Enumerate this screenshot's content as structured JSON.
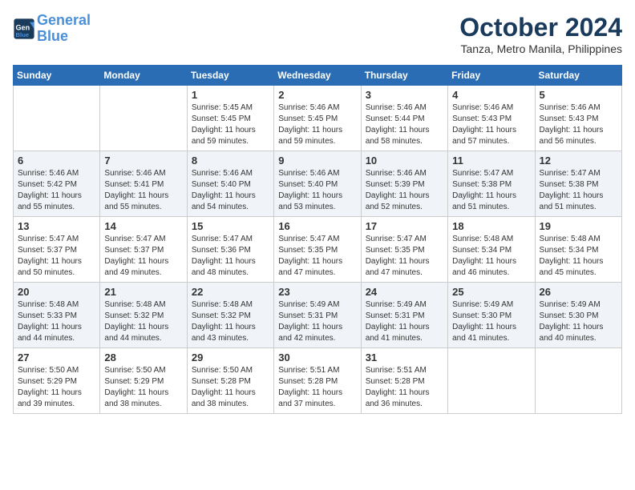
{
  "header": {
    "logo_line1": "General",
    "logo_line2": "Blue",
    "month": "October 2024",
    "location": "Tanza, Metro Manila, Philippines"
  },
  "days_of_week": [
    "Sunday",
    "Monday",
    "Tuesday",
    "Wednesday",
    "Thursday",
    "Friday",
    "Saturday"
  ],
  "weeks": [
    [
      {
        "day": "",
        "sunrise": "",
        "sunset": "",
        "daylight": ""
      },
      {
        "day": "",
        "sunrise": "",
        "sunset": "",
        "daylight": ""
      },
      {
        "day": "1",
        "sunrise": "Sunrise: 5:45 AM",
        "sunset": "Sunset: 5:45 PM",
        "daylight": "Daylight: 11 hours and 59 minutes."
      },
      {
        "day": "2",
        "sunrise": "Sunrise: 5:46 AM",
        "sunset": "Sunset: 5:45 PM",
        "daylight": "Daylight: 11 hours and 59 minutes."
      },
      {
        "day": "3",
        "sunrise": "Sunrise: 5:46 AM",
        "sunset": "Sunset: 5:44 PM",
        "daylight": "Daylight: 11 hours and 58 minutes."
      },
      {
        "day": "4",
        "sunrise": "Sunrise: 5:46 AM",
        "sunset": "Sunset: 5:43 PM",
        "daylight": "Daylight: 11 hours and 57 minutes."
      },
      {
        "day": "5",
        "sunrise": "Sunrise: 5:46 AM",
        "sunset": "Sunset: 5:43 PM",
        "daylight": "Daylight: 11 hours and 56 minutes."
      }
    ],
    [
      {
        "day": "6",
        "sunrise": "Sunrise: 5:46 AM",
        "sunset": "Sunset: 5:42 PM",
        "daylight": "Daylight: 11 hours and 55 minutes."
      },
      {
        "day": "7",
        "sunrise": "Sunrise: 5:46 AM",
        "sunset": "Sunset: 5:41 PM",
        "daylight": "Daylight: 11 hours and 55 minutes."
      },
      {
        "day": "8",
        "sunrise": "Sunrise: 5:46 AM",
        "sunset": "Sunset: 5:40 PM",
        "daylight": "Daylight: 11 hours and 54 minutes."
      },
      {
        "day": "9",
        "sunrise": "Sunrise: 5:46 AM",
        "sunset": "Sunset: 5:40 PM",
        "daylight": "Daylight: 11 hours and 53 minutes."
      },
      {
        "day": "10",
        "sunrise": "Sunrise: 5:46 AM",
        "sunset": "Sunset: 5:39 PM",
        "daylight": "Daylight: 11 hours and 52 minutes."
      },
      {
        "day": "11",
        "sunrise": "Sunrise: 5:47 AM",
        "sunset": "Sunset: 5:38 PM",
        "daylight": "Daylight: 11 hours and 51 minutes."
      },
      {
        "day": "12",
        "sunrise": "Sunrise: 5:47 AM",
        "sunset": "Sunset: 5:38 PM",
        "daylight": "Daylight: 11 hours and 51 minutes."
      }
    ],
    [
      {
        "day": "13",
        "sunrise": "Sunrise: 5:47 AM",
        "sunset": "Sunset: 5:37 PM",
        "daylight": "Daylight: 11 hours and 50 minutes."
      },
      {
        "day": "14",
        "sunrise": "Sunrise: 5:47 AM",
        "sunset": "Sunset: 5:37 PM",
        "daylight": "Daylight: 11 hours and 49 minutes."
      },
      {
        "day": "15",
        "sunrise": "Sunrise: 5:47 AM",
        "sunset": "Sunset: 5:36 PM",
        "daylight": "Daylight: 11 hours and 48 minutes."
      },
      {
        "day": "16",
        "sunrise": "Sunrise: 5:47 AM",
        "sunset": "Sunset: 5:35 PM",
        "daylight": "Daylight: 11 hours and 47 minutes."
      },
      {
        "day": "17",
        "sunrise": "Sunrise: 5:47 AM",
        "sunset": "Sunset: 5:35 PM",
        "daylight": "Daylight: 11 hours and 47 minutes."
      },
      {
        "day": "18",
        "sunrise": "Sunrise: 5:48 AM",
        "sunset": "Sunset: 5:34 PM",
        "daylight": "Daylight: 11 hours and 46 minutes."
      },
      {
        "day": "19",
        "sunrise": "Sunrise: 5:48 AM",
        "sunset": "Sunset: 5:34 PM",
        "daylight": "Daylight: 11 hours and 45 minutes."
      }
    ],
    [
      {
        "day": "20",
        "sunrise": "Sunrise: 5:48 AM",
        "sunset": "Sunset: 5:33 PM",
        "daylight": "Daylight: 11 hours and 44 minutes."
      },
      {
        "day": "21",
        "sunrise": "Sunrise: 5:48 AM",
        "sunset": "Sunset: 5:32 PM",
        "daylight": "Daylight: 11 hours and 44 minutes."
      },
      {
        "day": "22",
        "sunrise": "Sunrise: 5:48 AM",
        "sunset": "Sunset: 5:32 PM",
        "daylight": "Daylight: 11 hours and 43 minutes."
      },
      {
        "day": "23",
        "sunrise": "Sunrise: 5:49 AM",
        "sunset": "Sunset: 5:31 PM",
        "daylight": "Daylight: 11 hours and 42 minutes."
      },
      {
        "day": "24",
        "sunrise": "Sunrise: 5:49 AM",
        "sunset": "Sunset: 5:31 PM",
        "daylight": "Daylight: 11 hours and 41 minutes."
      },
      {
        "day": "25",
        "sunrise": "Sunrise: 5:49 AM",
        "sunset": "Sunset: 5:30 PM",
        "daylight": "Daylight: 11 hours and 41 minutes."
      },
      {
        "day": "26",
        "sunrise": "Sunrise: 5:49 AM",
        "sunset": "Sunset: 5:30 PM",
        "daylight": "Daylight: 11 hours and 40 minutes."
      }
    ],
    [
      {
        "day": "27",
        "sunrise": "Sunrise: 5:50 AM",
        "sunset": "Sunset: 5:29 PM",
        "daylight": "Daylight: 11 hours and 39 minutes."
      },
      {
        "day": "28",
        "sunrise": "Sunrise: 5:50 AM",
        "sunset": "Sunset: 5:29 PM",
        "daylight": "Daylight: 11 hours and 38 minutes."
      },
      {
        "day": "29",
        "sunrise": "Sunrise: 5:50 AM",
        "sunset": "Sunset: 5:28 PM",
        "daylight": "Daylight: 11 hours and 38 minutes."
      },
      {
        "day": "30",
        "sunrise": "Sunrise: 5:51 AM",
        "sunset": "Sunset: 5:28 PM",
        "daylight": "Daylight: 11 hours and 37 minutes."
      },
      {
        "day": "31",
        "sunrise": "Sunrise: 5:51 AM",
        "sunset": "Sunset: 5:28 PM",
        "daylight": "Daylight: 11 hours and 36 minutes."
      },
      {
        "day": "",
        "sunrise": "",
        "sunset": "",
        "daylight": ""
      },
      {
        "day": "",
        "sunrise": "",
        "sunset": "",
        "daylight": ""
      }
    ]
  ]
}
